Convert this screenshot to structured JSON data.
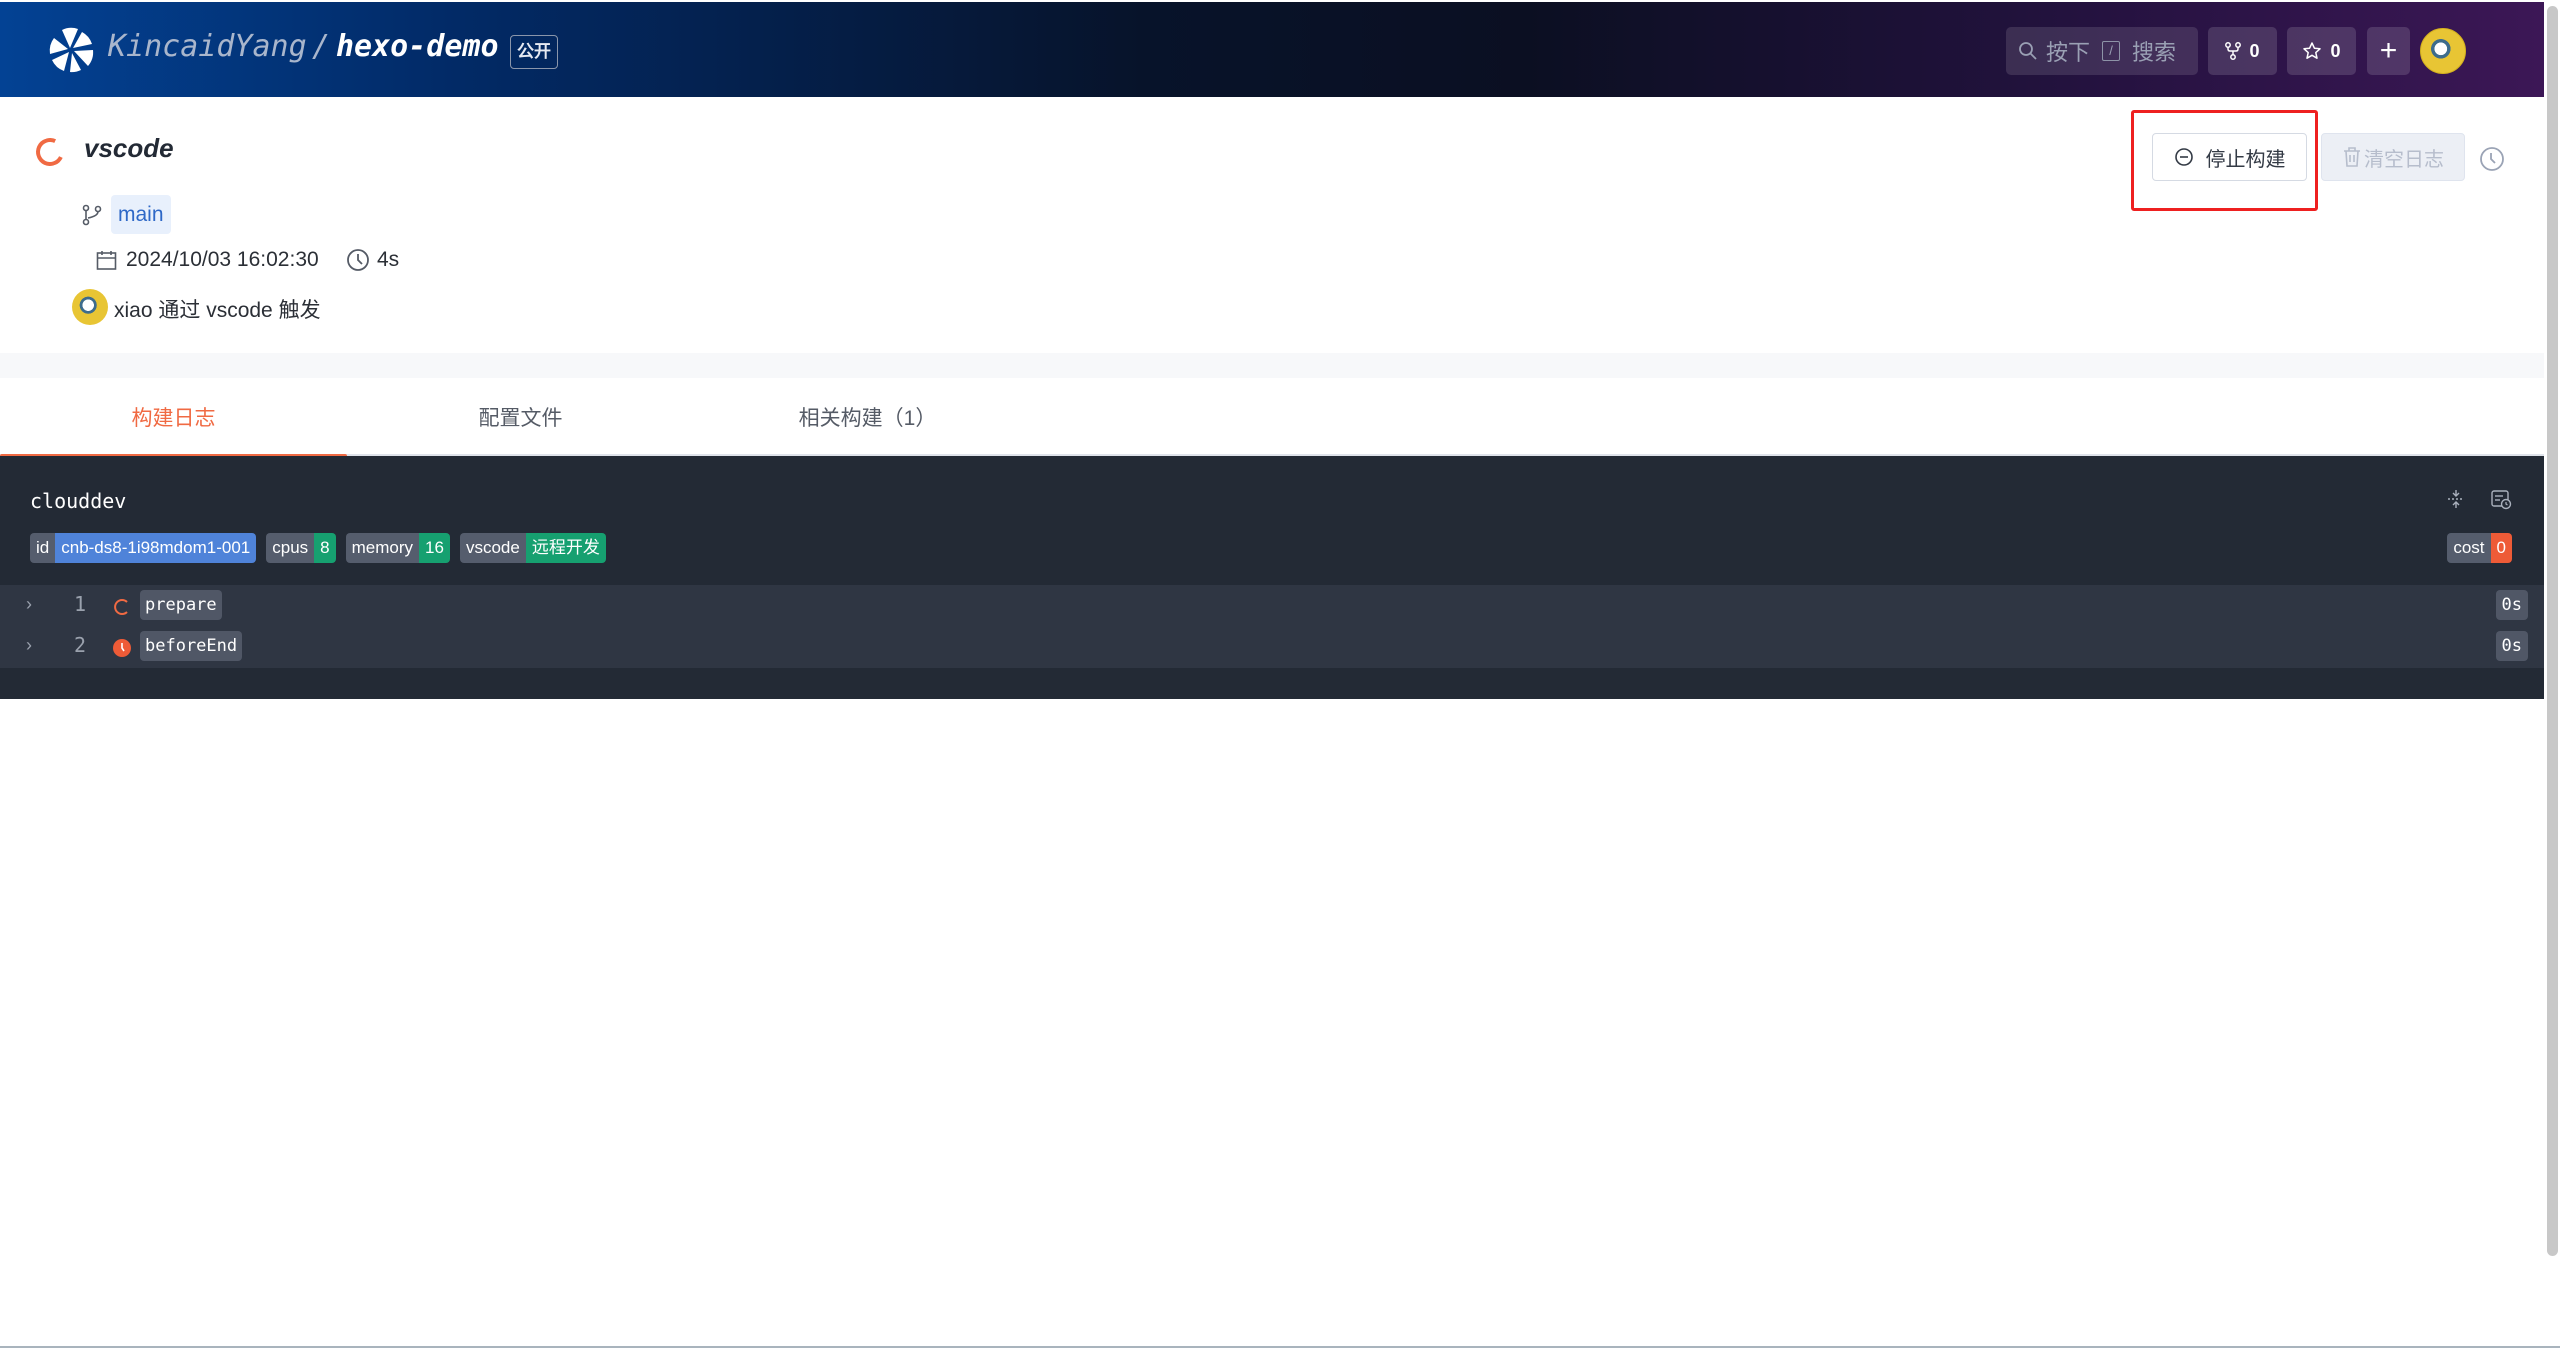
{
  "header": {
    "owner": "KincaidYang",
    "separator": "/",
    "repo": "hexo-demo",
    "visibility": "公开",
    "search": {
      "press": "按下",
      "key": "/",
      "label": "搜索"
    },
    "fork_count": "0",
    "star_count": "0",
    "plus_label": "+"
  },
  "build": {
    "title": "vscode",
    "status": "running",
    "branch": "main",
    "date": "2024/10/03 16:02:30",
    "duration": "4s",
    "trigger": "xiao 通过 vscode 触发"
  },
  "actions": {
    "stop_label": "停止构建",
    "clear_label": "清空日志"
  },
  "tabs": [
    {
      "label": "构建日志",
      "active": true
    },
    {
      "label": "配置文件",
      "active": false
    },
    {
      "label": "相关构建（1）",
      "active": false
    }
  ],
  "log": {
    "title": "clouddev",
    "badges": [
      {
        "key": "id",
        "value": "cnb-ds8-1i98mdom1-001",
        "color": "#4f83d9"
      },
      {
        "key": "cpus",
        "value": "8",
        "color": "#16a070"
      },
      {
        "key": "memory",
        "value": "16",
        "color": "#16a070"
      },
      {
        "key": "vscode",
        "value": "远程开发",
        "color": "#16a070"
      }
    ],
    "cost": {
      "key": "cost",
      "value": "0",
      "color": "#ee5b37"
    },
    "steps": [
      {
        "num": "1",
        "name": "prepare",
        "status": "running",
        "time": "0s"
      },
      {
        "num": "2",
        "name": "beforeEnd",
        "status": "pending",
        "time": "0s"
      }
    ]
  },
  "colors": {
    "accent": "#f06a43",
    "link": "#2e68c7",
    "highlight_box": "#ee2020"
  }
}
